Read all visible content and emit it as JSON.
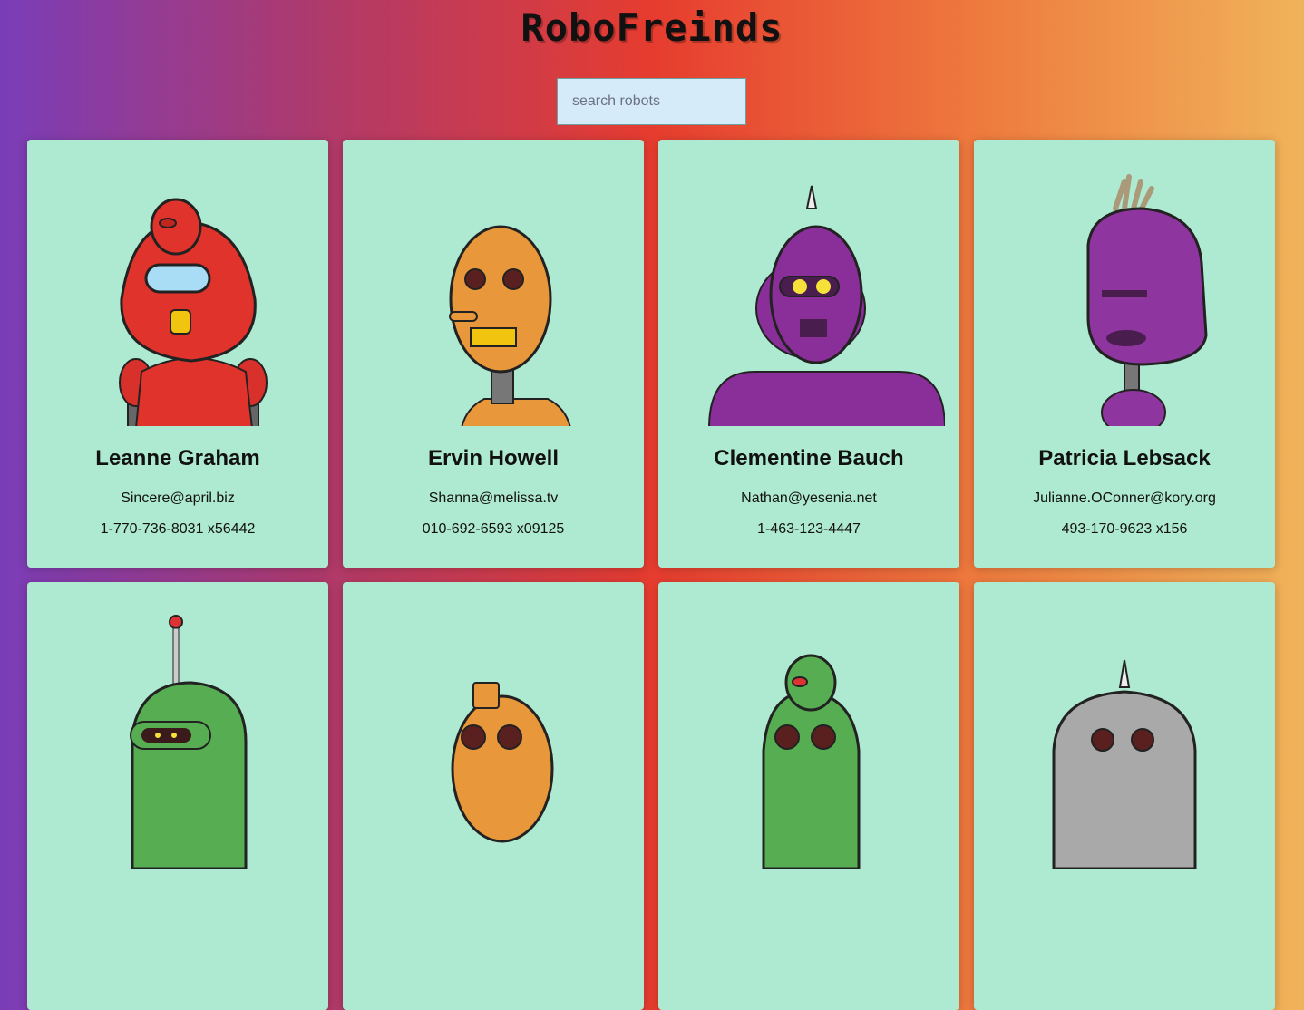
{
  "header": {
    "title": "RoboFreinds"
  },
  "search": {
    "placeholder": "search robots",
    "value": ""
  },
  "robots": [
    {
      "name": "Leanne Graham",
      "email": "Sincere@april.biz",
      "phone": "1-770-736-8031 x56442",
      "color": "#e0332b",
      "icon": "red-robot-avatar"
    },
    {
      "name": "Ervin Howell",
      "email": "Shanna@melissa.tv",
      "phone": "010-692-6593 x09125",
      "color": "#e8973a",
      "icon": "orange-robot-avatar"
    },
    {
      "name": "Clementine Bauch",
      "email": "Nathan@yesenia.net",
      "phone": "1-463-123-4447",
      "color": "#8a2e99",
      "icon": "purple-robot-avatar"
    },
    {
      "name": "Patricia Lebsack",
      "email": "Julianne.OConner@kory.org",
      "phone": "493-170-9623 x156",
      "color": "#8e35a0",
      "icon": "purple-robot-avatar"
    },
    {
      "name": "",
      "email": "",
      "phone": "",
      "color": "#57ad52",
      "icon": "green-robot-avatar"
    },
    {
      "name": "",
      "email": "",
      "phone": "",
      "color": "#e8973a",
      "icon": "orange-robot-avatar"
    },
    {
      "name": "",
      "email": "",
      "phone": "",
      "color": "#57ad52",
      "icon": "green-robot-avatar"
    },
    {
      "name": "",
      "email": "",
      "phone": "",
      "color": "#a9a9a9",
      "icon": "gray-robot-avatar"
    }
  ],
  "theme": {
    "card_bg": "#aee9d1",
    "search_bg": "#d6ebfa"
  }
}
